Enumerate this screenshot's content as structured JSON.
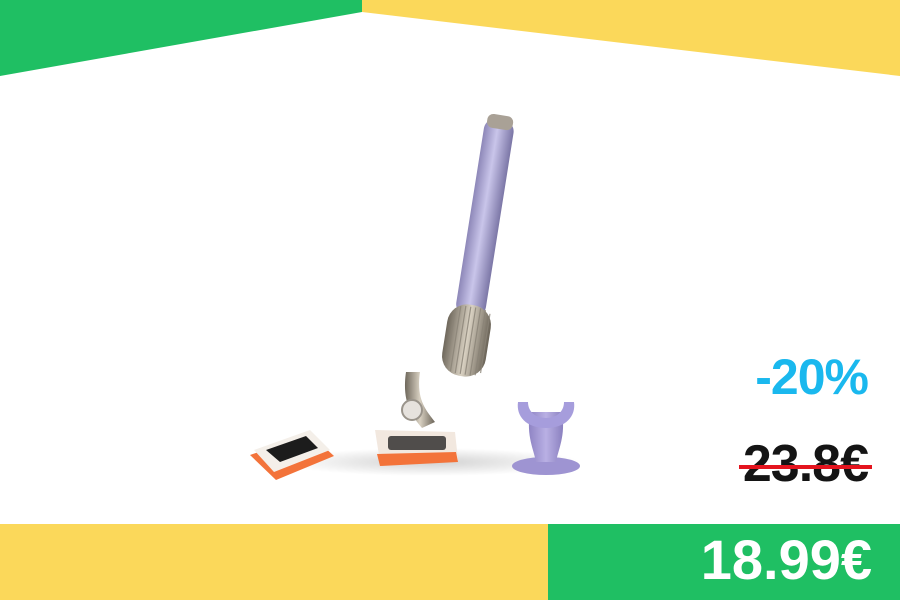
{
  "banner": {
    "discount": "-20%",
    "old_price": "23.8€",
    "new_price": "18.99€"
  },
  "colors": {
    "green": "#1fbf63",
    "yellow": "#fbd85a",
    "discount_blue": "#1ab8ee",
    "strike_red": "#e4141e",
    "price_text": "#ffffff"
  },
  "product": {
    "icon": "razor-with-stand-image"
  }
}
